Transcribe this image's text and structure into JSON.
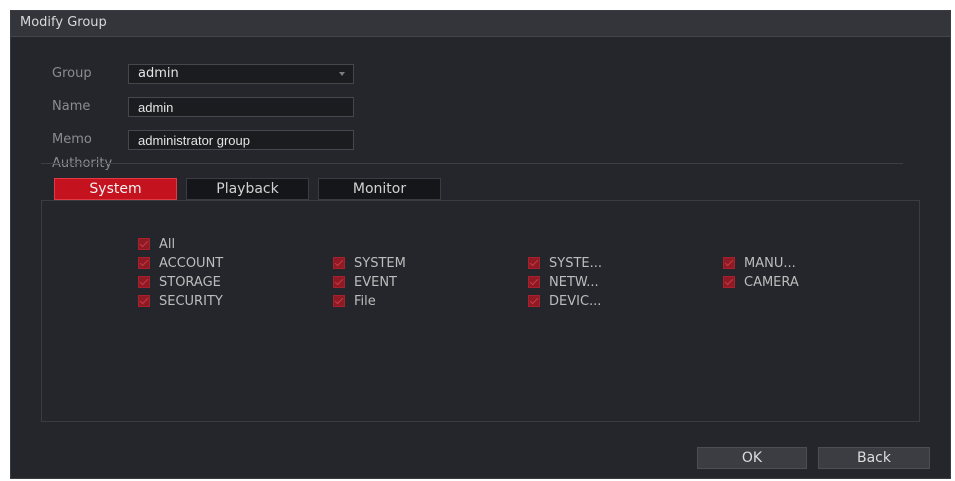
{
  "dialog": {
    "title": "Modify Group"
  },
  "form": {
    "group_label": "Group",
    "group_value": "admin",
    "name_label": "Name",
    "name_value": "admin",
    "memo_label": "Memo",
    "memo_value": "administrator group",
    "authority_label": "Authority"
  },
  "tabs": [
    {
      "label": "System",
      "active": true
    },
    {
      "label": "Playback",
      "active": false
    },
    {
      "label": "Monitor",
      "active": false
    }
  ],
  "permissions": {
    "all": {
      "label": "All",
      "checked": true
    },
    "items": [
      {
        "label": "ACCOUNT",
        "checked": true
      },
      {
        "label": "SYSTEM",
        "checked": true
      },
      {
        "label": "SYSTE...",
        "checked": true
      },
      {
        "label": "MANU...",
        "checked": true
      },
      {
        "label": "STORAGE",
        "checked": true
      },
      {
        "label": "EVENT",
        "checked": true
      },
      {
        "label": "NETW...",
        "checked": true
      },
      {
        "label": "CAMERA",
        "checked": true
      },
      {
        "label": "SECURITY",
        "checked": true
      },
      {
        "label": "File",
        "checked": true
      },
      {
        "label": "DEVIC...",
        "checked": true
      }
    ]
  },
  "buttons": {
    "ok_label": "OK",
    "back_label": "Back"
  },
  "colors": {
    "accent": "#c4121f",
    "background": "#24262b",
    "titlebar": "#33353b"
  }
}
